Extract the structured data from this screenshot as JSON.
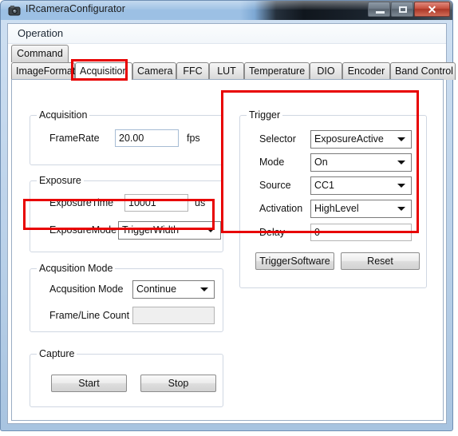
{
  "window": {
    "title": "IRcameraConfigurator",
    "icon": "camera-icon",
    "buttons": {
      "minimize": "minimize-icon",
      "maximize": "maximize-icon",
      "close": "✕"
    }
  },
  "menubar": {
    "items": [
      "Operation"
    ]
  },
  "tabs": {
    "row1": [
      {
        "label": "Command",
        "active": false
      }
    ],
    "row2": [
      {
        "label": "ImageFormat",
        "active": false
      },
      {
        "label": "Acquisition",
        "active": true
      },
      {
        "label": "Camera",
        "active": false
      },
      {
        "label": "FFC",
        "active": false
      },
      {
        "label": "LUT",
        "active": false
      },
      {
        "label": "Temperature",
        "active": false
      },
      {
        "label": "DIO",
        "active": false
      },
      {
        "label": "Encoder",
        "active": false
      },
      {
        "label": "Band Control",
        "active": false
      }
    ]
  },
  "acquisition_group": {
    "title": "Acquisition",
    "framerate_label": "FrameRate",
    "framerate_value": "20.00",
    "framerate_unit": "fps"
  },
  "exposure_group": {
    "title": "Exposure",
    "exposure_time_label": "ExposureTime",
    "exposure_time_value": "10001",
    "exposure_time_unit": "us",
    "exposure_mode_label": "ExposureMode",
    "exposure_mode_value": "TriggerWidth"
  },
  "acq_mode_group": {
    "title": "Acqusition Mode",
    "mode_label": "Acqusition Mode",
    "mode_value": "Continue",
    "frame_line_count_label": "Frame/Line Count",
    "frame_line_count_value": ""
  },
  "capture_group": {
    "title": "Capture",
    "start_label": "Start",
    "stop_label": "Stop"
  },
  "trigger_group": {
    "title": "Trigger",
    "selector_label": "Selector",
    "selector_value": "ExposureActive",
    "mode_label": "Mode",
    "mode_value": "On",
    "source_label": "Source",
    "source_value": "CC1",
    "activation_label": "Activation",
    "activation_value": "HighLevel",
    "delay_label": "Delay",
    "delay_value": "0",
    "trigger_software_label": "TriggerSoftware",
    "reset_label": "Reset"
  },
  "annotations": {
    "highlight_color": "#e80000",
    "boxes": [
      "acquisition-tab",
      "exposure-mode-row",
      "trigger-group"
    ]
  }
}
